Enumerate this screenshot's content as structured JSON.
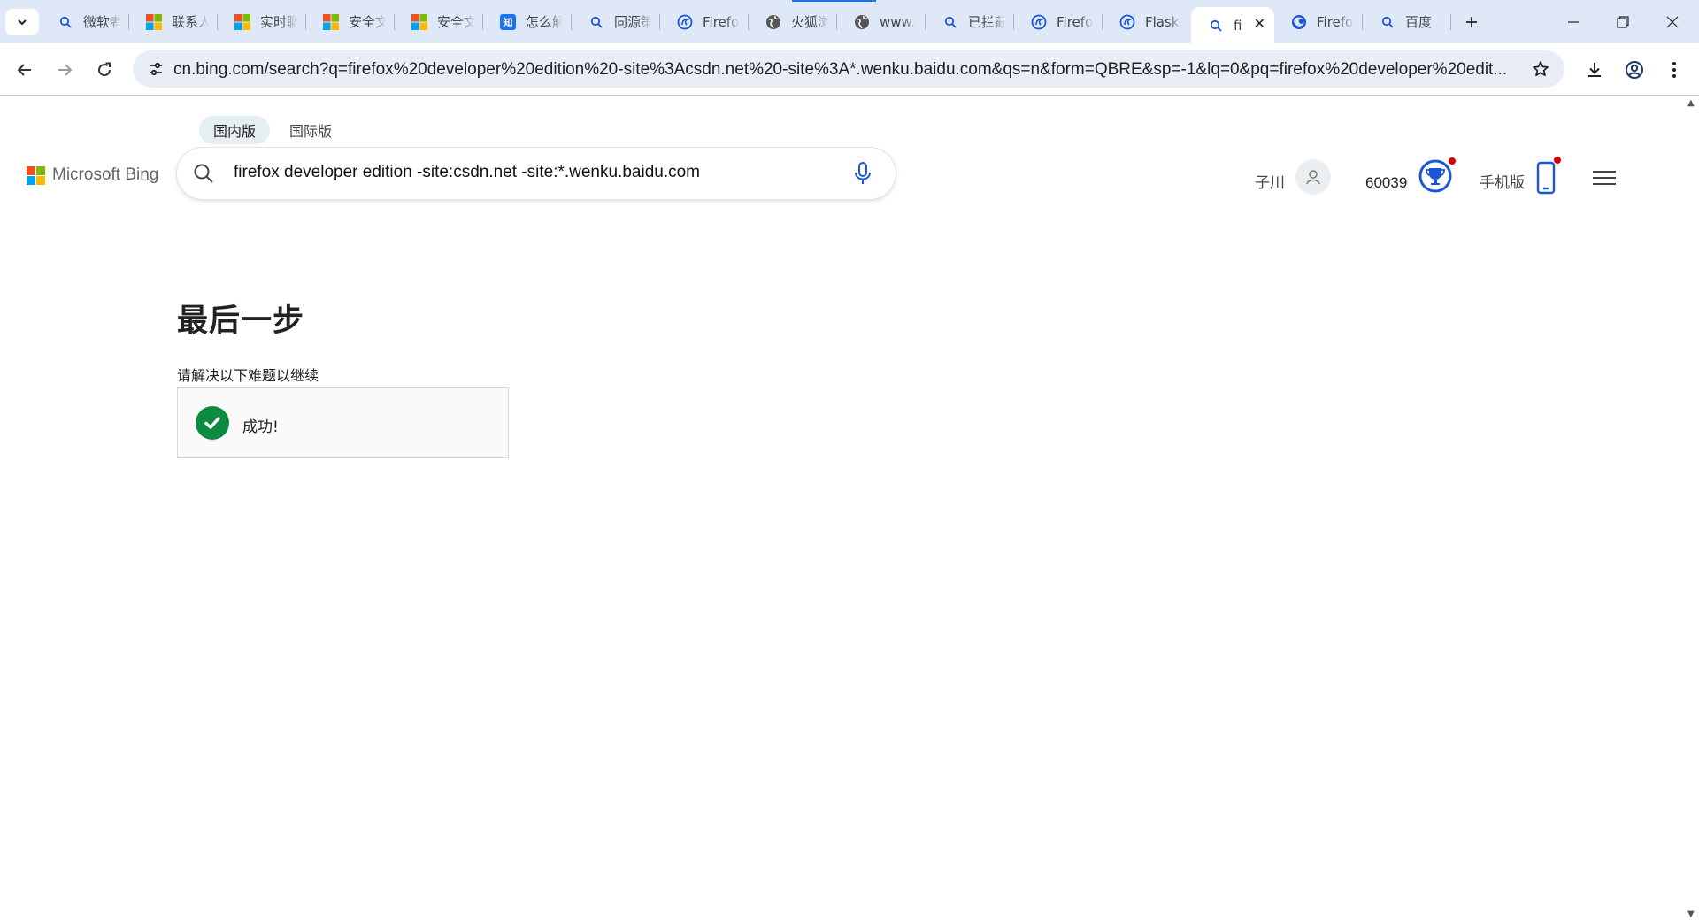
{
  "browser": {
    "tabs": [
      {
        "favicon": "search-icon",
        "title": "微软者"
      },
      {
        "favicon": "microsoft-logo-icon",
        "title": "联系人"
      },
      {
        "favicon": "microsoft-logo-icon",
        "title": "实时聊"
      },
      {
        "favicon": "microsoft-logo-icon",
        "title": "安全文"
      },
      {
        "favicon": "microsoft-logo-icon",
        "title": "安全文"
      },
      {
        "favicon": "zhihu-icon",
        "title": "怎么解"
      },
      {
        "favicon": "search-icon",
        "title": "同源策"
      },
      {
        "favicon": "firefox-dev-icon",
        "title": "Firefo"
      },
      {
        "favicon": "globe-icon",
        "title": "火狐浏"
      },
      {
        "favicon": "globe-icon",
        "title": "www."
      },
      {
        "favicon": "search-icon",
        "title": "已拦截"
      },
      {
        "favicon": "firefox-dev-icon",
        "title": "Firefo"
      },
      {
        "favicon": "firefox-dev-icon",
        "title": "Flask-"
      },
      {
        "favicon": "search-icon",
        "title": "fi",
        "active": true
      },
      {
        "favicon": "firefox-icon",
        "title": "Firefo"
      },
      {
        "favicon": "search-icon",
        "title": "百度"
      }
    ],
    "zhihu_glyph": "知",
    "url": "cn.bing.com/search?q=firefox%20developer%20edition%20-site%3Acsdn.net%20-site%3A*.wenku.baidu.com&qs=n&form=QBRE&sp=-1&lq=0&pq=firefox%20developer%20edit..."
  },
  "bing": {
    "scope_tabs": [
      "国内版",
      "国际版"
    ],
    "logo_text": "Microsoft Bing",
    "logo_colors": [
      "#f25022",
      "#7fba00",
      "#00a4ef",
      "#ffb900"
    ],
    "query": "firefox developer edition -site:csdn.net -site:*.wenku.baidu.com",
    "user_name": "子川",
    "points": "60039",
    "mobile_label": "手机版",
    "accent_color": "#1a56d6",
    "notification_color": "#d40000"
  },
  "challenge": {
    "title": "最后一步",
    "subtitle": "请解决以下难题以继续",
    "status": "成功!",
    "success_color": "#0c8a3f"
  }
}
